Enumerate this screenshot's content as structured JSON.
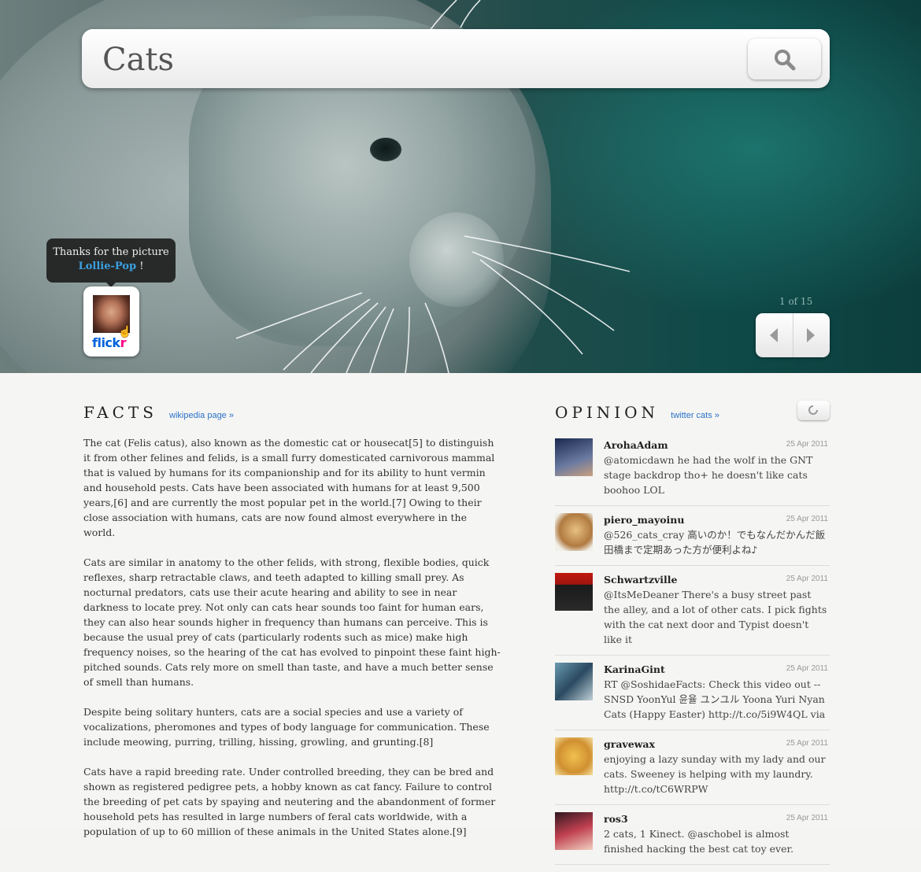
{
  "search": {
    "value": "Cats"
  },
  "attribution": {
    "line1": "Thanks for the picture",
    "name": "Lollie-Pop",
    "suffix": " !",
    "logo_text_1": "flick",
    "logo_text_2": "r"
  },
  "pager": {
    "text": "1 of 15"
  },
  "facts": {
    "title": "FACTS",
    "link": "wikipedia page »",
    "paragraphs": [
      "The cat (Felis catus), also known as the domestic cat or housecat[5] to distinguish it from other felines and felids, is a small furry domesticated carnivorous mammal that is valued by humans for its companionship and for its ability to hunt vermin and household pests. Cats have been associated with humans for at least 9,500 years,[6] and are currently the most popular pet in the world.[7] Owing to their close association with humans, cats are now found almost everywhere in the world.",
      "Cats are similar in anatomy to the other felids, with strong, flexible bodies, quick reflexes, sharp retractable claws, and teeth adapted to killing small prey. As nocturnal predators, cats use their acute hearing and ability to see in near darkness to locate prey. Not only can cats hear sounds too faint for human ears, they can also hear sounds higher in frequency than humans can perceive. This is because the usual prey of cats (particularly rodents such as mice) make high frequency noises, so the hearing of the cat has evolved to pinpoint these faint high-pitched sounds. Cats rely more on smell than taste, and have a much better sense of smell than humans.",
      "Despite being solitary hunters, cats are a social species and use a variety of vocalizations, pheromones and types of body language for communication. These include meowing, purring, trilling, hissing, growling, and grunting.[8]",
      "Cats have a rapid breeding rate. Under controlled breeding, they can be bred and shown as registered pedigree pets, a hobby known as cat fancy. Failure to control the breeding of pet cats by spaying and neutering and the abandonment of former household pets has resulted in large numbers of feral cats worldwide, with a population of up to 60 million of these animals in the United States alone.[9]"
    ]
  },
  "opinion": {
    "title": "OPINION",
    "link": "twitter cats »",
    "tweets": [
      {
        "user": "ArohaAdam",
        "date": "25 Apr 2011",
        "text": "@atomicdawn he had the wolf in the GNT stage backdrop tho+ he doesn't like cats boohoo LOL",
        "avatar_color": "#2a3a6a"
      },
      {
        "user": "piero_mayoinu",
        "date": "25 Apr 2011",
        "text": "@526_cats_cray 高いのか！でもなんだかんだ飯田橋まで定期あった方が便利よね♪",
        "avatar_color": "#c9974f"
      },
      {
        "user": "Schwartzville",
        "date": "25 Apr 2011",
        "text": "@ItsMeDeaner There's a busy street past the alley, and a lot of other cats. I pick fights with the cat next door and Typist doesn't like it",
        "avatar_color": "#8a1a14"
      },
      {
        "user": "KarinaGint",
        "date": "25 Apr 2011",
        "text": "RT @SoshidaeFacts: Check this video out -- SNSD YoonYul 윤율 ユンユル Yoona Yuri Nyan Cats (Happy Easter) http://t.co/5i9W4QL via",
        "avatar_color": "#5a8aa0"
      },
      {
        "user": "gravewax",
        "date": "25 Apr 2011",
        "text": "enjoying a lazy sunday with my lady and our cats. Sweeney is helping with my laundry. http://t.co/tC6WRPW",
        "avatar_color": "#e0b040"
      },
      {
        "user": "ros3",
        "date": "25 Apr 2011",
        "text": "2 cats, 1 Kinect. @aschobel is almost finished hacking the best cat toy ever.",
        "avatar_color": "#b04050"
      }
    ]
  }
}
